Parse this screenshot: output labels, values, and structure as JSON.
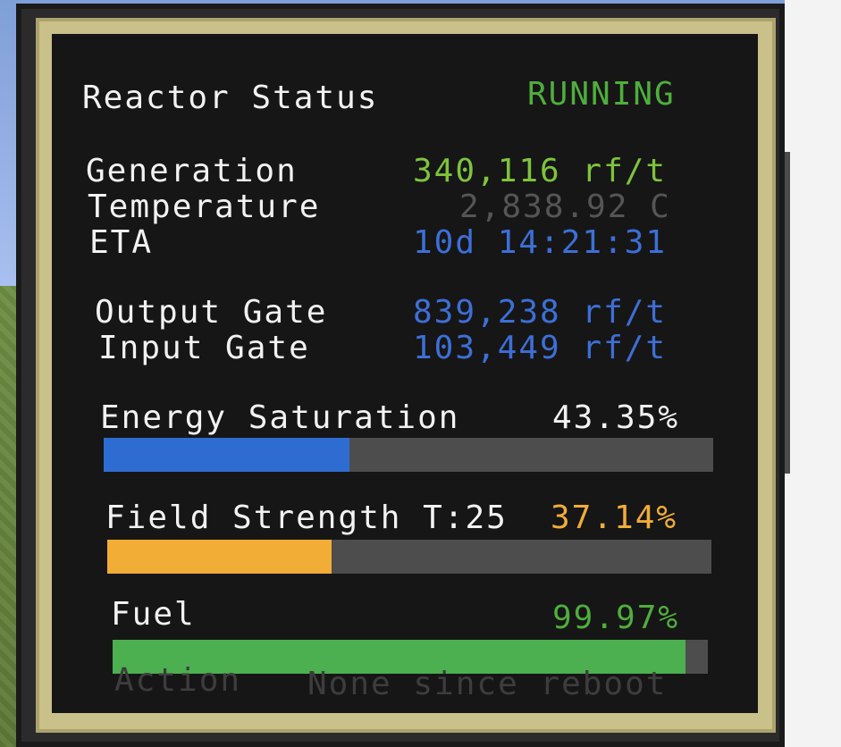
{
  "header": {
    "title": "Reactor Status",
    "status": "RUNNING"
  },
  "stats": {
    "generation": {
      "label": "Generation",
      "value": "340,116 rf/t"
    },
    "temperature": {
      "label": "Temperature",
      "value": "2,838.92 C"
    },
    "eta": {
      "label": "ETA",
      "value": "10d 14:21:31"
    }
  },
  "gates": {
    "output": {
      "label": "Output Gate",
      "value": "839,238 rf/t"
    },
    "input": {
      "label": "Input Gate",
      "value": "103,449 rf/t"
    }
  },
  "bars": {
    "energy": {
      "label": "Energy Saturation",
      "value_text": "43.35%",
      "fraction": 0.4035,
      "color": "#2f6cd2"
    },
    "field": {
      "label": "Field Strength T:25",
      "value_text": "37.14%",
      "fraction": 0.3714,
      "color": "#f2ad36"
    },
    "fuel": {
      "label": "Fuel",
      "value_text": "99.97%",
      "fraction": 0.9627,
      "color": "#4caf50"
    }
  },
  "footer": {
    "action_label": "Action",
    "action_value": "None since reboot"
  },
  "colors": {
    "running": "#4fae3c",
    "generation": "#7ec43b",
    "blue": "#3d6fd8",
    "temperature": "#555555"
  }
}
